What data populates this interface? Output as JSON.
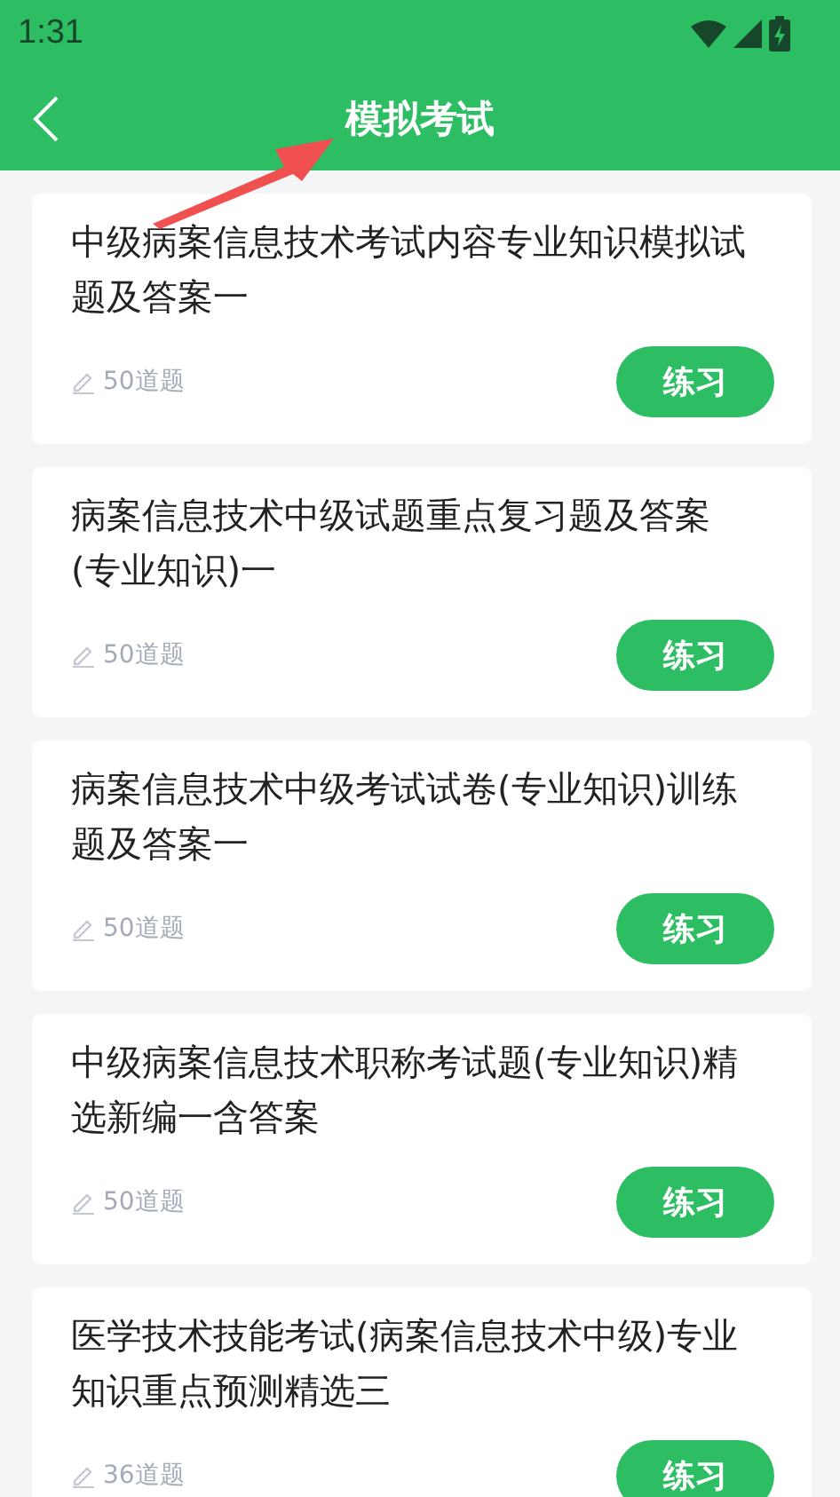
{
  "status_bar": {
    "time": "1:31"
  },
  "app_bar": {
    "title": "模拟考试"
  },
  "exams": [
    {
      "title": "中级病案信息技术考试内容专业知识模拟试题及答案一",
      "count": "50道题",
      "button": "练习"
    },
    {
      "title": "病案信息技术中级试题重点复习题及答案(专业知识)一",
      "count": "50道题",
      "button": "练习"
    },
    {
      "title": "病案信息技术中级考试试卷(专业知识)训练题及答案一",
      "count": "50道题",
      "button": "练习"
    },
    {
      "title": "中级病案信息技术职称考试题(专业知识)精选新编一含答案",
      "count": "50道题",
      "button": "练习"
    },
    {
      "title": "医学技术技能考试(病案信息技术中级)专业知识重点预测精选三",
      "count": "36道题",
      "button": "练习"
    }
  ]
}
